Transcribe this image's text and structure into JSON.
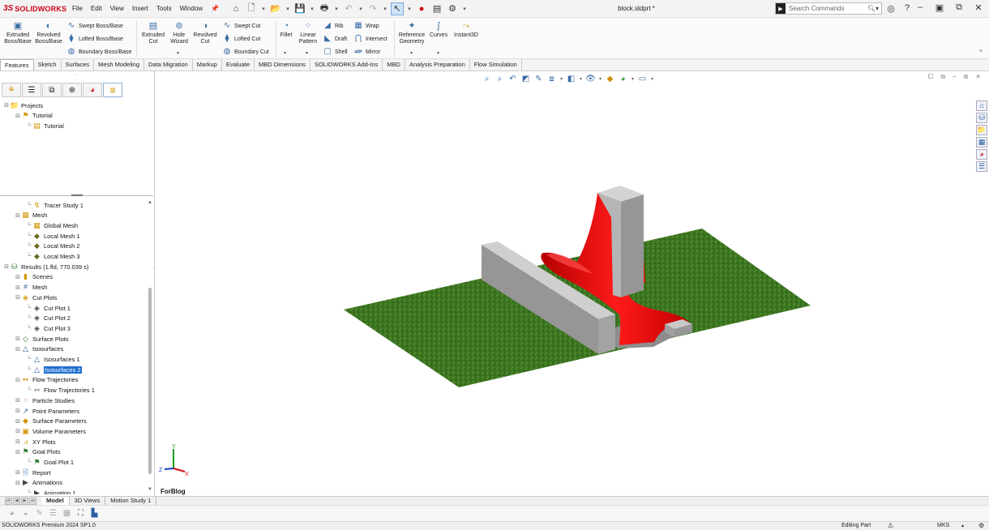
{
  "app": {
    "brand_prefix": "3S",
    "brand_name": "SOLIDWORKS",
    "document_title": "block.sldprt *"
  },
  "menu": [
    "File",
    "Edit",
    "View",
    "Insert",
    "Tools",
    "Window"
  ],
  "search": {
    "placeholder": "Search Commands"
  },
  "ribbon": {
    "extruded_boss": "Extruded Boss/Base",
    "revolved_boss": "Revolved Boss/Base",
    "swept_boss": "Swept Boss/Base",
    "lofted_boss": "Lofted Boss/Base",
    "boundary_boss": "Boundary Boss/Base",
    "extruded_cut": "Extruded Cut",
    "hole_wizard": "Hole Wizard",
    "revolved_cut": "Revolved Cut",
    "swept_cut": "Swept Cut",
    "lofted_cut": "Lofted Cut",
    "boundary_cut": "Boundary Cut",
    "fillet": "Fillet",
    "linear_pattern": "Linear Pattern",
    "rib": "Rib",
    "draft": "Draft",
    "shell": "Shell",
    "wrap": "Wrap",
    "intersect": "Intersect",
    "mirror": "Mirror",
    "reference_geometry": "Reference Geometry",
    "curves": "Curves",
    "instant3d": "Instant3D"
  },
  "command_tabs": [
    "Features",
    "Sketch",
    "Surfaces",
    "Mesh Modeling",
    "Data Migration",
    "Markup",
    "Evaluate",
    "MBD Dimensions",
    "SOLIDWORKS Add-Ins",
    "MBD",
    "Analysis Preparation",
    "Flow Simulation"
  ],
  "active_command_tab": "Features",
  "tree_top": [
    {
      "label": "Projects",
      "indent": 0,
      "icon": "projects-icon"
    },
    {
      "label": "Tutorial",
      "indent": 1,
      "icon": "project-icon"
    },
    {
      "label": "Tutorial",
      "indent": 2,
      "icon": "configuration-icon"
    }
  ],
  "tree": [
    {
      "label": "Tracer Study 1",
      "indent": 2,
      "icon": "tracer-icon"
    },
    {
      "label": "Mesh",
      "indent": 1,
      "icon": "mesh-folder-icon"
    },
    {
      "label": "Global Mesh",
      "indent": 2,
      "icon": "global-mesh-icon"
    },
    {
      "label": "Local Mesh 1",
      "indent": 2,
      "icon": "local-mesh-icon"
    },
    {
      "label": "Local Mesh 2",
      "indent": 2,
      "icon": "local-mesh-icon"
    },
    {
      "label": "Local Mesh 3",
      "indent": 2,
      "icon": "local-mesh-icon"
    },
    {
      "label": "Results (1.fld, 770.039 s)",
      "indent": 0,
      "icon": "results-icon"
    },
    {
      "label": "Scenes",
      "indent": 1,
      "icon": "scenes-icon"
    },
    {
      "label": "Mesh",
      "indent": 1,
      "icon": "mesh-icon"
    },
    {
      "label": "Cut Plots",
      "indent": 1,
      "icon": "cut-plots-icon"
    },
    {
      "label": "Cut Plot 1",
      "indent": 2,
      "icon": "cut-plot-icon"
    },
    {
      "label": "Cut Plot 2",
      "indent": 2,
      "icon": "cut-plot-icon"
    },
    {
      "label": "Cut Plot 3",
      "indent": 2,
      "icon": "cut-plot-icon"
    },
    {
      "label": "Surface Plots",
      "indent": 1,
      "icon": "surface-plots-icon"
    },
    {
      "label": "Isosurfaces",
      "indent": 1,
      "icon": "isosurfaces-icon"
    },
    {
      "label": "Isosurfaces 1",
      "indent": 2,
      "icon": "isosurface-icon"
    },
    {
      "label": "Isosurfaces 2",
      "indent": 2,
      "icon": "isosurface-icon",
      "selected": true
    },
    {
      "label": "Flow Trajectories",
      "indent": 1,
      "icon": "flow-trajectories-icon"
    },
    {
      "label": "Flow Trajectories 1",
      "indent": 2,
      "icon": "flow-trajectory-icon"
    },
    {
      "label": "Particle Studies",
      "indent": 1,
      "icon": "particle-studies-icon"
    },
    {
      "label": "Point Parameters",
      "indent": 1,
      "icon": "point-parameters-icon"
    },
    {
      "label": "Surface Parameters",
      "indent": 1,
      "icon": "surface-parameters-icon"
    },
    {
      "label": "Volume Parameters",
      "indent": 1,
      "icon": "volume-parameters-icon"
    },
    {
      "label": "XY Plots",
      "indent": 1,
      "icon": "xy-plots-icon"
    },
    {
      "label": "Goal Plots",
      "indent": 1,
      "icon": "goal-plots-icon"
    },
    {
      "label": "Goal Plot 1",
      "indent": 2,
      "icon": "goal-plot-icon"
    },
    {
      "label": "Report",
      "indent": 1,
      "icon": "report-icon"
    },
    {
      "label": "Animations",
      "indent": 1,
      "icon": "animations-icon"
    },
    {
      "label": "Animation 1",
      "indent": 2,
      "icon": "animation-icon"
    }
  ],
  "bottom_tabs": [
    "Model",
    "3D Views",
    "Motion Study 1"
  ],
  "active_bottom_tab": "Model",
  "viewport": {
    "corner_label": "ForBlog"
  },
  "status": {
    "product": "SOLIDWORKS Premium 2024 SP1.0",
    "mode": "Editing Part",
    "units": "MKS"
  },
  "colors": {
    "brand": "#d0021b",
    "selection": "#1f6fd1",
    "isosurface": "#e00000",
    "ground": "#3d7a1f",
    "block": "#b0b0b0"
  }
}
